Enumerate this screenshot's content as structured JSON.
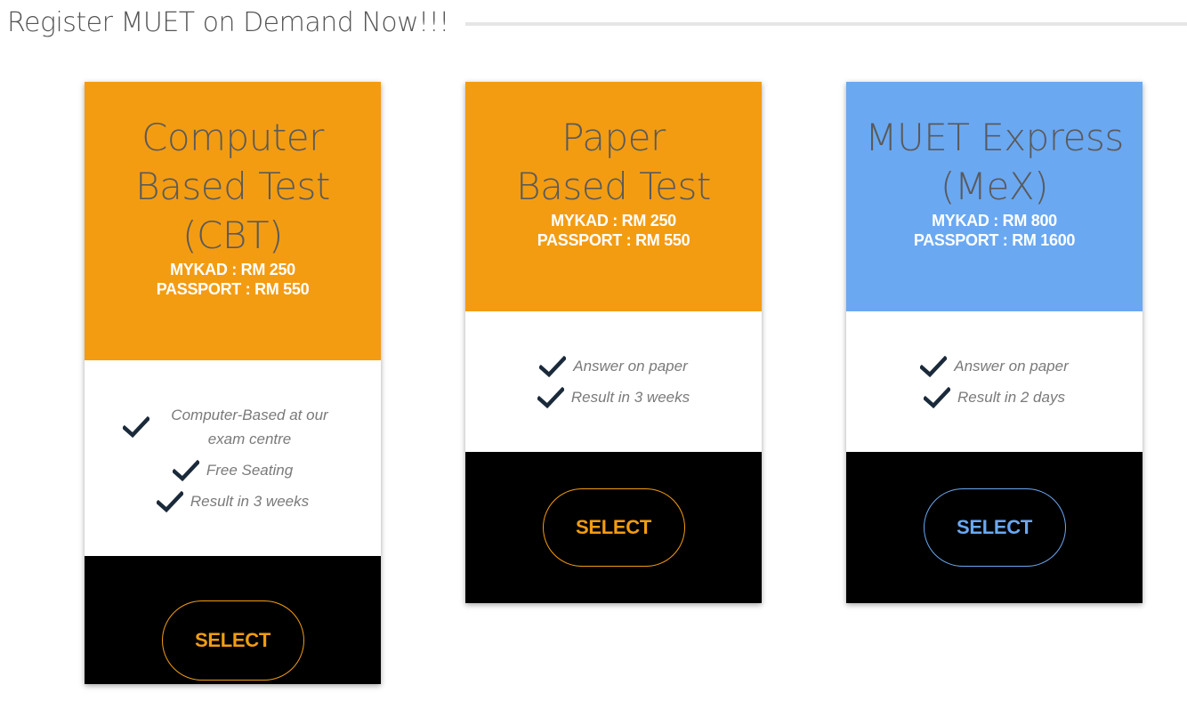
{
  "header": {
    "title": "Register MUET on Demand Now!!!"
  },
  "cards": [
    {
      "title_lines": [
        "Computer",
        "Based Test",
        "(CBT)"
      ],
      "price_mykad": "MYKAD : RM 250",
      "price_passport": "PASSPORT : RM 550",
      "features": [
        "Computer-Based at our exam centre",
        "Free Seating",
        "Result in 3 weeks"
      ],
      "button_label": "SELECT",
      "color": "#f39c12"
    },
    {
      "title_lines": [
        "Paper",
        "Based Test"
      ],
      "price_mykad": "MYKAD : RM 250",
      "price_passport": "PASSPORT : RM 550",
      "features": [
        "Answer on paper",
        "Result in 3 weeks"
      ],
      "button_label": "SELECT",
      "color": "#f39c12"
    },
    {
      "title_lines": [
        "MUET Express",
        "(MeX)"
      ],
      "price_mykad": "MYKAD : RM 800",
      "price_passport": "PASSPORT : RM 1600",
      "features": [
        "Answer on paper",
        "Result in 2 days"
      ],
      "button_label": "SELECT",
      "color": "#6aa8f2"
    }
  ],
  "icons": {
    "check": "check-icon"
  }
}
